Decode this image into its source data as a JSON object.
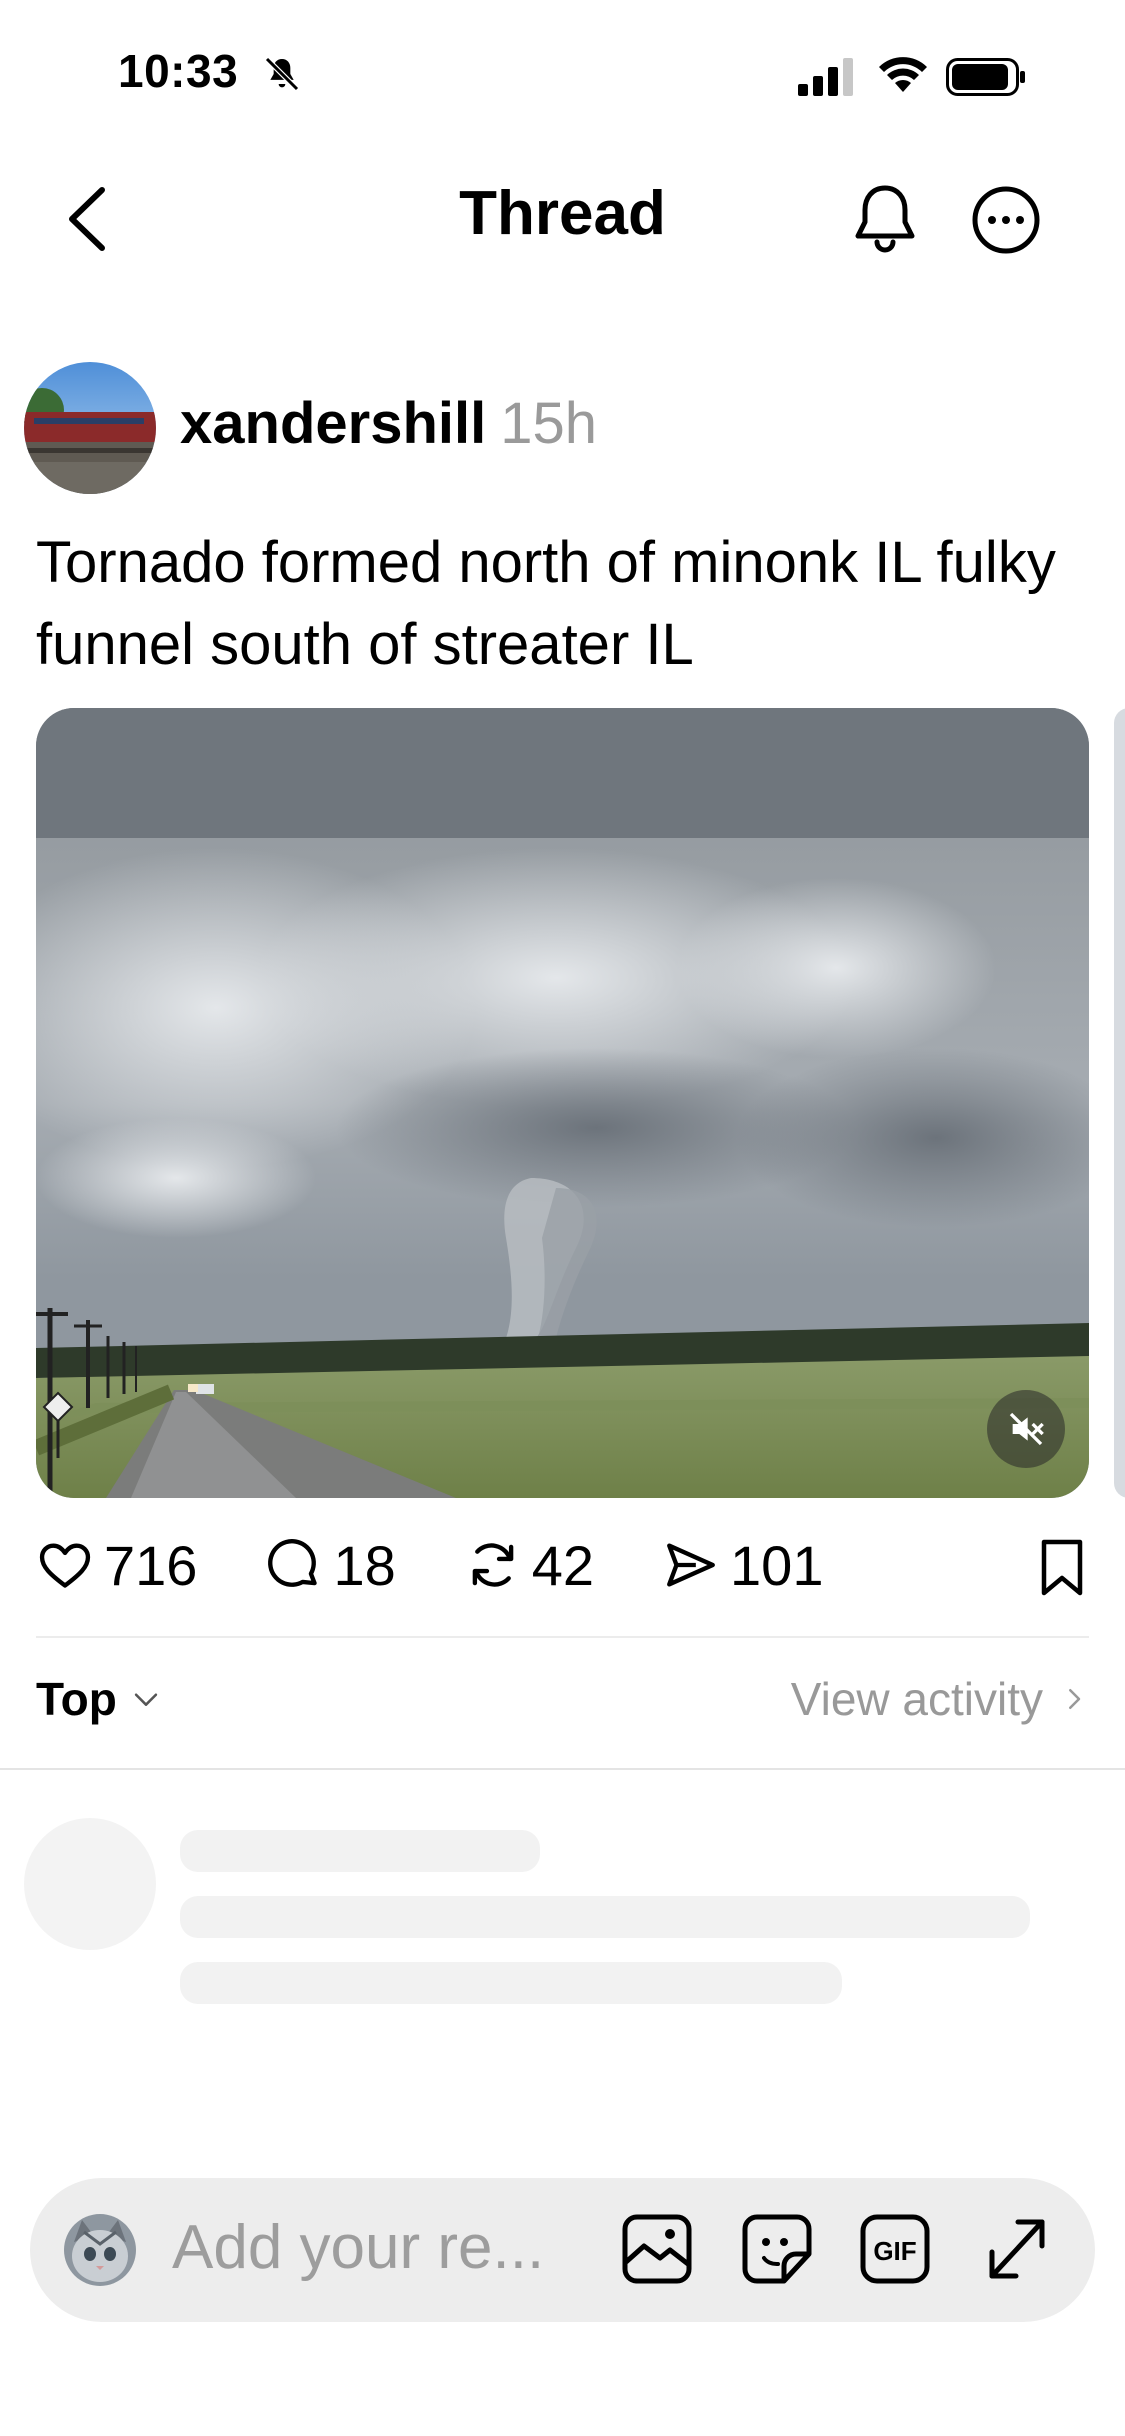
{
  "status_bar": {
    "time": "10:33"
  },
  "nav": {
    "title": "Thread"
  },
  "post": {
    "username": "xandershill",
    "time_ago": "15h",
    "text": "Tornado formed north of minonk IL fulky funnel south of streater IL",
    "stats": {
      "likes": "716",
      "comments": "18",
      "reposts": "42",
      "shares": "101"
    }
  },
  "replies": {
    "sort_label": "Top",
    "activity_label": "View activity"
  },
  "reply_bar": {
    "placeholder": "Add your re..."
  },
  "icons": [
    "bell-off-icon",
    "signal-icon",
    "wifi-icon",
    "battery-icon",
    "back-icon",
    "bell-icon",
    "more-icon",
    "heart-icon",
    "comment-icon",
    "repost-icon",
    "share-icon",
    "bookmark-icon",
    "mute-icon",
    "chevron-down-icon",
    "chevron-right-icon",
    "image-icon",
    "sticker-icon",
    "gif-icon",
    "expand-icon"
  ]
}
